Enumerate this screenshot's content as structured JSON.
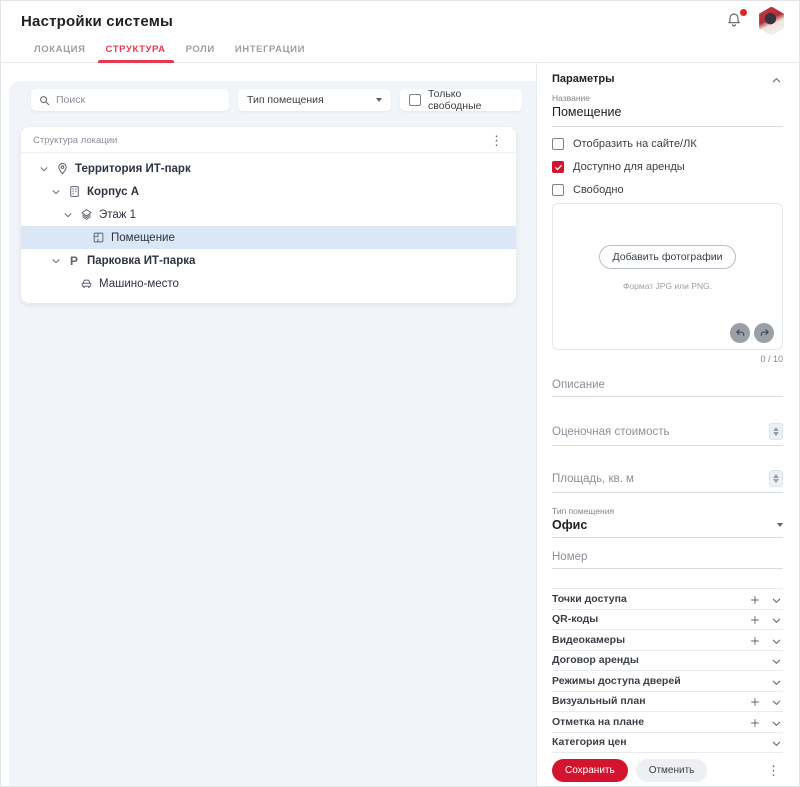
{
  "header": {
    "title": "Настройки системы",
    "icons": [
      "bell-icon",
      "notification-dot",
      "avatar"
    ]
  },
  "tabs": [
    {
      "label": "ЛОКАЦИЯ",
      "active": false
    },
    {
      "label": "СТРУКТУРА",
      "active": true
    },
    {
      "label": "РОЛИ",
      "active": false
    },
    {
      "label": "ИНТЕГРАЦИИ",
      "active": false
    }
  ],
  "filters": {
    "search_placeholder": "Поиск",
    "room_type_label": "Тип помещения",
    "only_free_label": "Только свободные"
  },
  "tree": {
    "title": "Структура локации",
    "items": [
      {
        "label": "Территория ИТ-парк",
        "icon": "location-pin-icon",
        "level": 0,
        "bold": true,
        "expanded": true,
        "selected": false
      },
      {
        "label": "Корпус А",
        "icon": "building-icon",
        "level": 1,
        "bold": true,
        "expanded": true,
        "selected": false
      },
      {
        "label": "Этаж 1",
        "icon": "layers-icon",
        "level": 2,
        "bold": false,
        "expanded": true,
        "selected": false
      },
      {
        "label": "Помещение",
        "icon": "room-icon",
        "level": 3,
        "bold": false,
        "expanded": false,
        "selected": true
      },
      {
        "label": "Парковка ИТ-парка",
        "icon": "parking-icon",
        "icon_glyph": "P",
        "level": 1,
        "bold": true,
        "expanded": true,
        "selected": false
      },
      {
        "label": "Машино-место",
        "icon": "car-icon",
        "level": 2,
        "bold": false,
        "expanded": false,
        "selected": false
      }
    ]
  },
  "params": {
    "title": "Параметры",
    "name_label": "Название",
    "name_value": "Помещение",
    "checkboxes": [
      {
        "label": "Отобразить на сайте/ЛК",
        "checked": false
      },
      {
        "label": "Доступно для аренды",
        "checked": true
      },
      {
        "label": "Свободно",
        "checked": false
      }
    ],
    "photo": {
      "add_button": "Добавить фотографии",
      "hint": "Формат JPG или PNG.",
      "counter": "0 / 10"
    },
    "fields": {
      "description_placeholder": "Описание",
      "cost_placeholder": "Оценочная стоимость",
      "area_placeholder": "Площадь, кв. м",
      "room_type_label": "Тип помещения",
      "room_type_value": "Офис",
      "number_placeholder": "Номер"
    },
    "accordions": [
      {
        "label": "Точки доступа",
        "has_add": true
      },
      {
        "label": "QR-коды",
        "has_add": true
      },
      {
        "label": "Видеокамеры",
        "has_add": true
      },
      {
        "label": "Договор аренды",
        "has_add": false
      },
      {
        "label": "Режимы доступа дверей",
        "has_add": false
      },
      {
        "label": "Визуальный план",
        "has_add": true
      },
      {
        "label": "Отметка на плане",
        "has_add": true
      },
      {
        "label": "Категория цен",
        "has_add": false
      }
    ],
    "actions": {
      "save": "Сохранить",
      "cancel": "Отменить"
    }
  },
  "colors": {
    "accent_red": "#d4142e",
    "tab_active_red": "#e63950",
    "selected_row_blue": "#dbe7f6",
    "panel_bg": "#f1f4f8"
  }
}
